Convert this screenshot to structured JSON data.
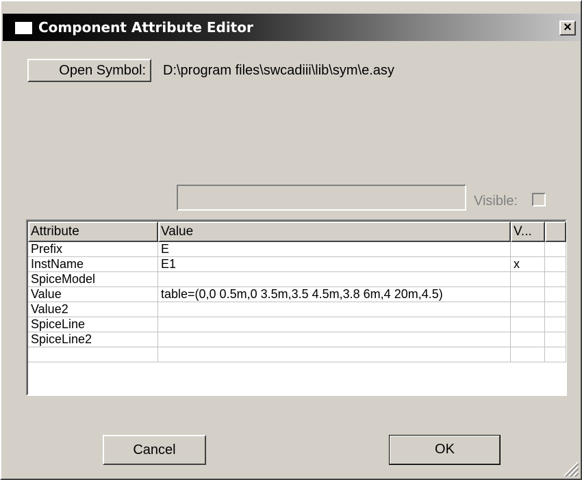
{
  "window": {
    "title": "Component Attribute Editor",
    "close_label": "×"
  },
  "symbol": {
    "button_label": "Open Symbol:",
    "path": "D:\\program files\\swcadiii\\lib\\sym\\e.asy"
  },
  "editor": {
    "input_value": "",
    "visible_label": "Visible:"
  },
  "table": {
    "headers": [
      "Attribute",
      "Value",
      "V...",
      ""
    ],
    "rows": [
      {
        "attribute": "Prefix",
        "value": "E",
        "visible": ""
      },
      {
        "attribute": "InstName",
        "value": "E1",
        "visible": "x"
      },
      {
        "attribute": "SpiceModel",
        "value": "",
        "visible": ""
      },
      {
        "attribute": "Value",
        "value": "table=(0,0 0.5m,0 3.5m,3.5 4.5m,3.8 6m,4 20m,4.5)",
        "visible": ""
      },
      {
        "attribute": "Value2",
        "value": "",
        "visible": ""
      },
      {
        "attribute": "SpiceLine",
        "value": "",
        "visible": ""
      },
      {
        "attribute": "SpiceLine2",
        "value": "",
        "visible": ""
      },
      {
        "attribute": "",
        "value": "",
        "visible": ""
      }
    ]
  },
  "buttons": {
    "cancel": "Cancel",
    "ok": "OK"
  },
  "colors": {
    "face": "#d4d0c8",
    "title_start": "#000000",
    "title_end": "#c8c8c8",
    "grid_bg": "#ffffff"
  }
}
